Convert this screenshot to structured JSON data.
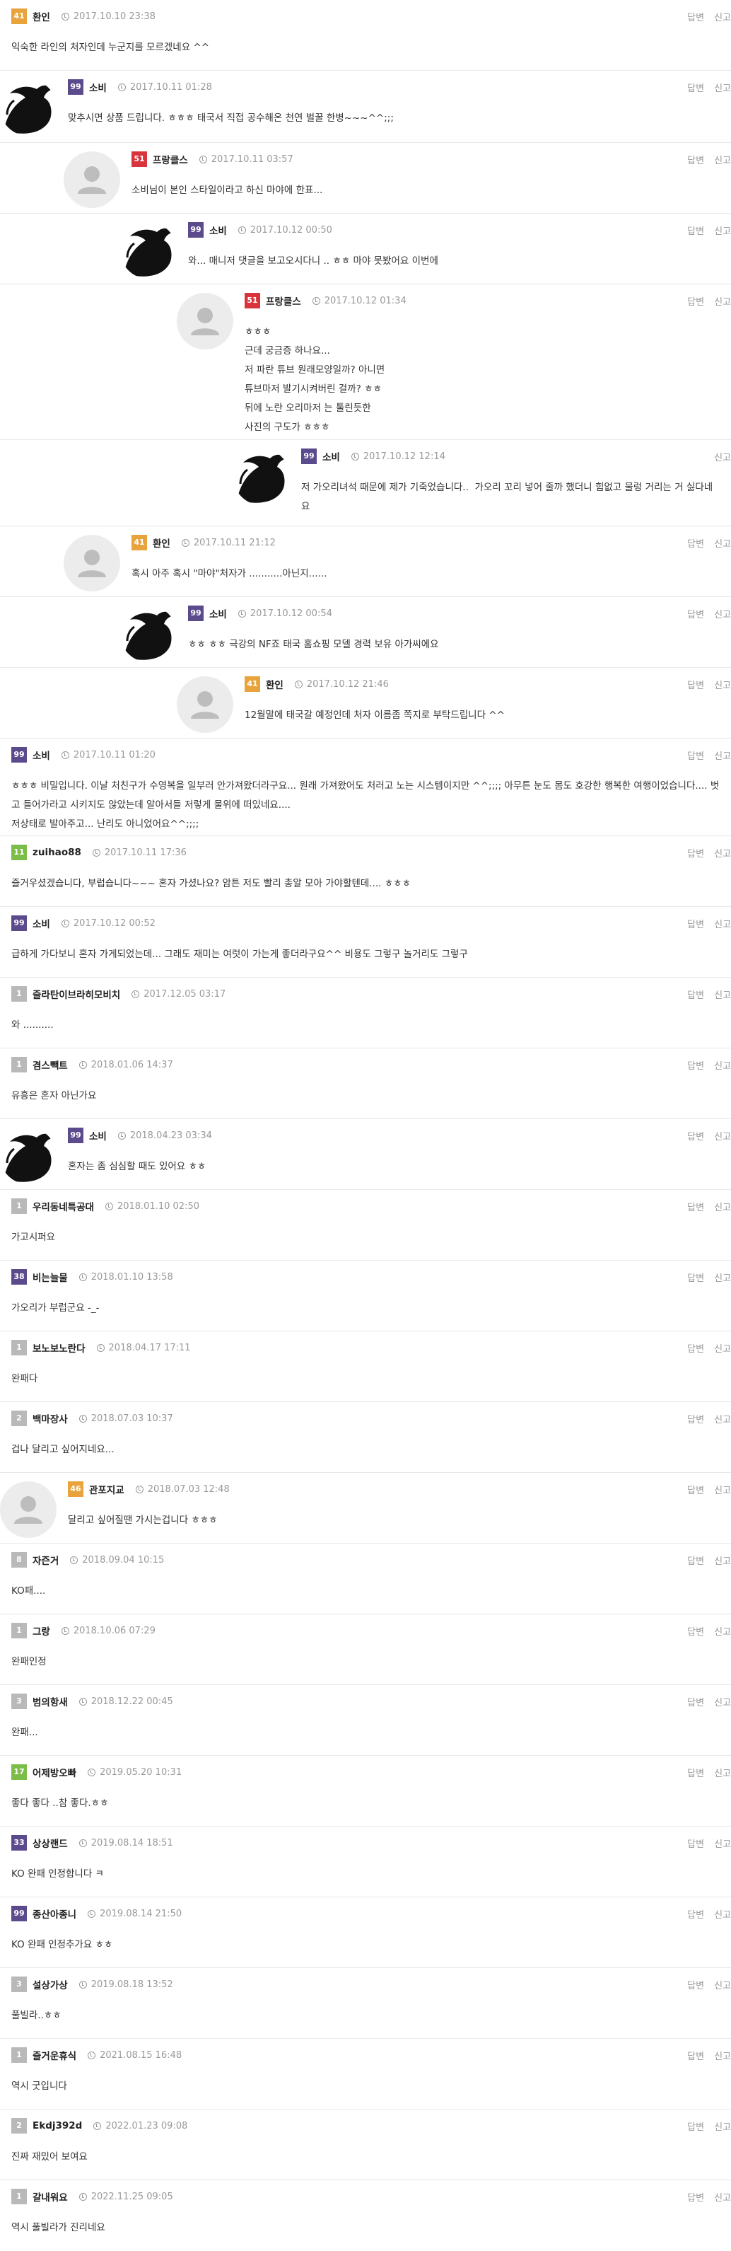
{
  "actions": {
    "reply": "답변",
    "report": "신고"
  },
  "colors": {
    "orange": "#e8a33d",
    "purple": "#5b4a8c",
    "red": "#d9343b",
    "green": "#7cbd4a",
    "grey": "#b9b9b9"
  },
  "comments": [
    {
      "level": "41",
      "level_color": "orange",
      "name": "환인",
      "date": "2017.10.10 23:38",
      "body": "익숙한 라인의 처자인데 누군지를 모르겠네요 ^^",
      "avatar": "none",
      "reply": true
    },
    {
      "level": "99",
      "level_color": "purple",
      "name": "소비",
      "date": "2017.10.11 01:28",
      "body": "맞추시면 상품 드립니다. ㅎㅎㅎ 태국서 직접 공수해온 천연 벌꿀 한병~~~^^;;;",
      "avatar": "black",
      "reply": true
    },
    {
      "level": "51",
      "level_color": "red",
      "name": "프랑클스",
      "date": "2017.10.11 03:57",
      "body": "소비님이 본인 스타일이라고 하신 마야에 한표...",
      "avatar": "grey",
      "reply": true
    },
    {
      "level": "99",
      "level_color": "purple",
      "name": "소비",
      "date": "2017.10.12 00:50",
      "body": "와... 매니저 댓글을 보고오시다니 .. ㅎㅎ 마야 못봤어요 이번에",
      "avatar": "black",
      "reply": true
    },
    {
      "level": "51",
      "level_color": "red",
      "name": "프랑클스",
      "date": "2017.10.12 01:34",
      "body": "ㅎㅎㅎ\n근데 궁금증 하나요...\n저 파란 튜브 원래모양일까? 아니면\n튜브마저 발기시켜버린 걸까? ㅎㅎ\n뒤에 노란 오리마저 는 툴린듯한\n사진의 구도가 ㅎㅎㅎ",
      "avatar": "grey",
      "reply": true
    },
    {
      "level": "99",
      "level_color": "purple",
      "name": "소비",
      "date": "2017.10.12 12:14",
      "body": "저 가오리녀석 때문에 제가 기죽었습니다..  가오리 꼬리 넣어 줄까 했더니 힘없고 물렁 거리는 거 싫다네요",
      "avatar": "black",
      "reply": false
    },
    {
      "level": "41",
      "level_color": "orange",
      "name": "환인",
      "date": "2017.10.11 21:12",
      "body": "혹시 아주 혹시 \"마야\"처자가 ...........아닌지......",
      "avatar": "grey",
      "reply": true
    },
    {
      "level": "99",
      "level_color": "purple",
      "name": "소비",
      "date": "2017.10.12 00:54",
      "body": "ㅎㅎ ㅎㅎ 극강의 NF죠 태국 홈쇼핑 모델 경력 보유 아가씨에요",
      "avatar": "black",
      "reply": true
    },
    {
      "level": "41",
      "level_color": "orange",
      "name": "환인",
      "date": "2017.10.12 21:46",
      "body": "12월말에 태국갈 예정인데 처자 이름좀 쪽지로 부탁드립니다 ^^",
      "avatar": "grey",
      "reply": true
    },
    {
      "level": "99",
      "level_color": "purple",
      "name": "소비",
      "date": "2017.10.11 01:20",
      "body": "ㅎㅎㅎ 비밀입니다. 이날 처친구가 수영복을 일부러 안가져왔더라구요... 원래 가져왔어도 처러고 노는 시스템이지만 ^^;;;; 아무튼 눈도 몸도 호강한 행복한 여행이었습니다.... 벗고 들어가라고 시키지도 않았는데 알아서들 저렇게 물위에 떠있네요....\n저상태로 발아주고... 난리도 아니었어요^^;;;;",
      "avatar": "none",
      "reply": true
    },
    {
      "level": "11",
      "level_color": "green",
      "name": "zuihao88",
      "date": "2017.10.11 17:36",
      "body": "즐거우셨겠습니다, 부럽습니다~~~ 혼자 가셨나요? 암튼 저도 빨리 총알 모아 가야할텐데.... ㅎㅎㅎ",
      "avatar": "none",
      "reply": true
    },
    {
      "level": "99",
      "level_color": "purple",
      "name": "소비",
      "date": "2017.10.12 00:52",
      "body": "급하게 가다보니 혼자 가게되었는데... 그래도 재미는 여럿이 가는게 좋더라구요^^ 비용도 그렇구 놀거리도 그렇구",
      "avatar": "none",
      "reply": true
    },
    {
      "level": "1",
      "level_color": "grey",
      "name": "즐라탄이브라히모비치",
      "date": "2017.12.05 03:17",
      "body": "와 ..........",
      "avatar": "none",
      "reply": true
    },
    {
      "level": "1",
      "level_color": "grey",
      "name": "겸스빽트",
      "date": "2018.01.06 14:37",
      "body": "유흥은 혼자 아닌가요",
      "avatar": "none",
      "reply": true
    },
    {
      "level": "99",
      "level_color": "purple",
      "name": "소비",
      "date": "2018.04.23 03:34",
      "body": "혼자는 좀 심심할 때도 있어요 ㅎㅎ",
      "avatar": "black",
      "reply": true
    },
    {
      "level": "1",
      "level_color": "grey",
      "name": "우리동네특공대",
      "date": "2018.01.10 02:50",
      "body": "가고시퍼요",
      "avatar": "none",
      "reply": true
    },
    {
      "level": "38",
      "level_color": "purple",
      "name": "비는늘물",
      "date": "2018.01.10 13:58",
      "body": "가오리가 부럽군요 -_-",
      "avatar": "none",
      "reply": true
    },
    {
      "level": "1",
      "level_color": "grey",
      "name": "보노보노란다",
      "date": "2018.04.17 17:11",
      "body": "완패다",
      "avatar": "none",
      "reply": true
    },
    {
      "level": "2",
      "level_color": "grey",
      "name": "백마장사",
      "date": "2018.07.03 10:37",
      "body": "겁나 달리고 싶어지네요...",
      "avatar": "none",
      "reply": true
    },
    {
      "level": "46",
      "level_color": "orange",
      "name": "관포지교",
      "date": "2018.07.03 12:48",
      "body": "달리고 싶어질땐 가시는겁니다 ㅎㅎㅎ",
      "avatar": "grey",
      "reply": true
    },
    {
      "level": "8",
      "level_color": "grey",
      "name": "자즌거",
      "date": "2018.09.04 10:15",
      "body": "KO패....",
      "avatar": "none",
      "reply": true
    },
    {
      "level": "1",
      "level_color": "grey",
      "name": "그랑",
      "date": "2018.10.06 07:29",
      "body": "완패인정",
      "avatar": "none",
      "reply": true
    },
    {
      "level": "3",
      "level_color": "grey",
      "name": "범의항새",
      "date": "2018.12.22 00:45",
      "body": "완패...",
      "avatar": "none",
      "reply": true
    },
    {
      "level": "17",
      "level_color": "green",
      "name": "어제방오빠",
      "date": "2019.05.20 10:31",
      "body": "좋다 좋다 ..참 좋다.ㅎㅎ",
      "avatar": "none",
      "reply": true
    },
    {
      "level": "33",
      "level_color": "purple",
      "name": "상상랜드",
      "date": "2019.08.14 18:51",
      "body": "KO 완패 인정합니다 ㅋ",
      "avatar": "none",
      "reply": true
    },
    {
      "level": "99",
      "level_color": "purple",
      "name": "종산아종니",
      "date": "2019.08.14 21:50",
      "body": "KO 완패 인정추가요 ㅎㅎ",
      "avatar": "none",
      "reply": true
    },
    {
      "level": "3",
      "level_color": "grey",
      "name": "설상가상",
      "date": "2019.08.18 13:52",
      "body": "풀빌라..ㅎㅎ",
      "avatar": "none",
      "reply": true
    },
    {
      "level": "1",
      "level_color": "grey",
      "name": "즐거운휴식",
      "date": "2021.08.15 16:48",
      "body": "역시 굿입니다",
      "avatar": "none",
      "reply": true
    },
    {
      "level": "2",
      "level_color": "grey",
      "name": "Ekdj392d",
      "date": "2022.01.23 09:08",
      "body": "진짜 재밌어 보여요",
      "avatar": "none",
      "reply": true
    },
    {
      "level": "1",
      "level_color": "grey",
      "name": "갈내워요",
      "date": "2022.11.25 09:05",
      "body": "역시 풀빌라가 진리네요",
      "avatar": "none",
      "reply": true
    }
  ]
}
